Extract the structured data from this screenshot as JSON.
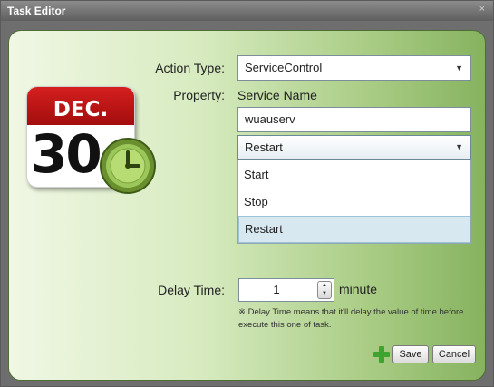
{
  "window": {
    "title": "Task Editor",
    "close_glyph": "×"
  },
  "form": {
    "action_type_label": "Action Type:",
    "action_type_value": "ServiceControl",
    "property_label": "Property:",
    "property_value": "Service Name",
    "service_name_value": "wuauserv",
    "operation_value": "Restart",
    "operation_options": [
      "Start",
      "Stop",
      "Restart"
    ],
    "delay_label": "Delay Time:",
    "delay_value": "1",
    "delay_unit": "minute",
    "delay_note": "※ Delay Time means  that it'll delay the value of time before execute this one of task."
  },
  "calendar": {
    "month": "DEC.",
    "day": "30"
  },
  "buttons": {
    "save": "Save",
    "cancel": "Cancel"
  },
  "colors": {
    "panel_green": "#aacd86",
    "calendar_red": "#d51f1f",
    "selected_option": "#d7e8f1",
    "add_icon": "#3fa32f"
  },
  "icons": [
    "calendar-icon",
    "clock-icon",
    "dropdown-arrow-icon",
    "spinner-up-icon",
    "spinner-down-icon",
    "add-icon",
    "close-icon"
  ]
}
